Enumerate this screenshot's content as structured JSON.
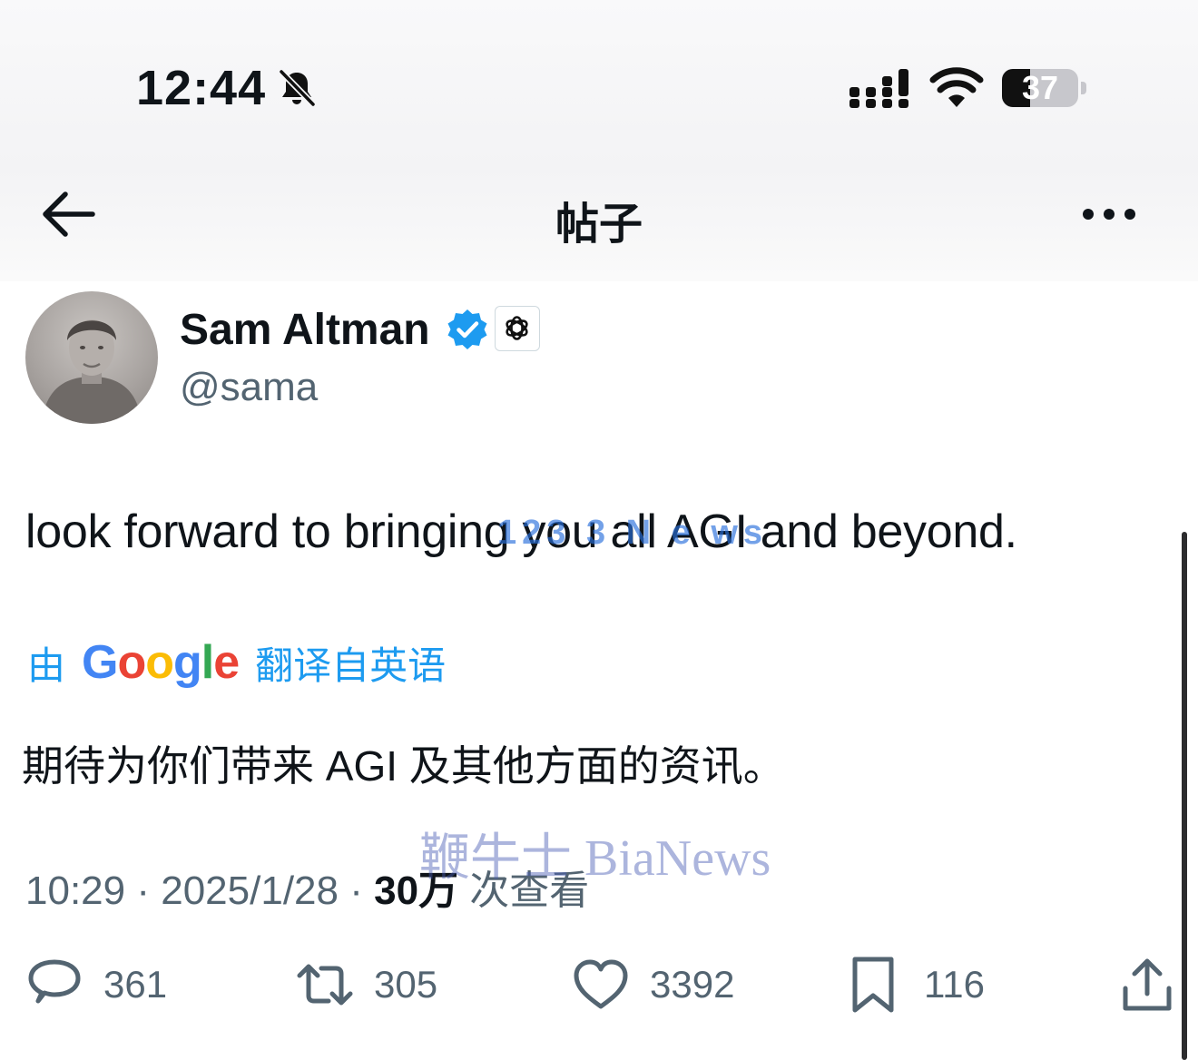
{
  "status_bar": {
    "time": "12:44",
    "battery": "37",
    "battery_level": 0.37,
    "icons": [
      "bell-slash-icon",
      "cellular-signal-icon",
      "wifi-icon",
      "battery-icon"
    ]
  },
  "header": {
    "title": "帖子",
    "back_icon": "arrow-left-icon",
    "more_icon": "ellipsis-icon"
  },
  "author": {
    "name": "Sam Altman",
    "handle": "@sama",
    "verified_icon": "verified-badge-icon",
    "affiliation_icon": "openai-logo-icon"
  },
  "tweet": {
    "text": "look forward to bringing you all AGI and beyond."
  },
  "translation": {
    "prefix": "由",
    "provider": "Google",
    "suffix": "翻译自英语",
    "text": "期待为你们带来 AGI 及其他方面的资讯。"
  },
  "meta": {
    "time": "10:29",
    "separator": "·",
    "date": "2025/1/28",
    "views_count": "30万",
    "views_label": "次查看"
  },
  "actions": {
    "replies": "361",
    "retweets": "305",
    "likes": "3392",
    "bookmarks": "116"
  },
  "watermarks": {
    "overlay_1": "123 3 N e ws",
    "overlay_2": "鞭牛士 BiaNews"
  },
  "colors": {
    "accent": "#1d9bf0",
    "text": "#0f1419",
    "secondary_text": "#536471",
    "google_blue": "#4285F4",
    "google_red": "#EA4335",
    "google_yellow": "#FBBC05",
    "google_green": "#34A853"
  }
}
